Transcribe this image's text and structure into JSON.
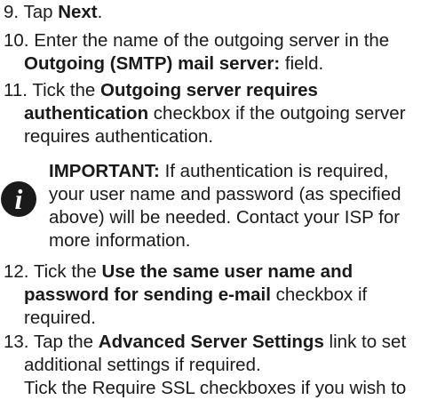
{
  "steps": [
    {
      "number": "9.",
      "parts": [
        {
          "t": "Tap ",
          "b": false
        },
        {
          "t": "Next",
          "b": true
        },
        {
          "t": ".",
          "b": false
        }
      ]
    },
    {
      "number": "10.",
      "line1": "Enter the name of the outgoing server in the",
      "line2_bold": "Outgoing (SMTP) mail server:",
      "line2_rest": " field."
    },
    {
      "number": "11.",
      "line1_pre": "Tick the ",
      "line1_bold": "Outgoing server requires",
      "line2_bold": "authentication",
      "line2_rest": " checkbox if the outgoing server",
      "line3": "requires authentication."
    },
    {
      "number": "12.",
      "line1_pre": "Tick the ",
      "line1_bold": "Use the same user name and",
      "line2_bold": "password for sending e-mail",
      "line2_rest": " checkbox if",
      "line3": "required."
    },
    {
      "number": "13.",
      "line1_pre": "Tap the ",
      "line1_bold": "Advanced Server Settings",
      "line1_rest": " link to set",
      "line2": "additional settings if required.",
      "line3": "Tick the Require SSL checkboxes if you wish to"
    }
  ],
  "note": {
    "icon": "info-icon",
    "label": "IMPORTANT:",
    "line1_rest": " If authentication is required,",
    "line2": "your user name and password (as specified",
    "line3": "above) will be needed. Contact your ISP for",
    "line4": "more information."
  },
  "colors": {
    "text": "#1a1a1a",
    "background": "#ffffff"
  }
}
